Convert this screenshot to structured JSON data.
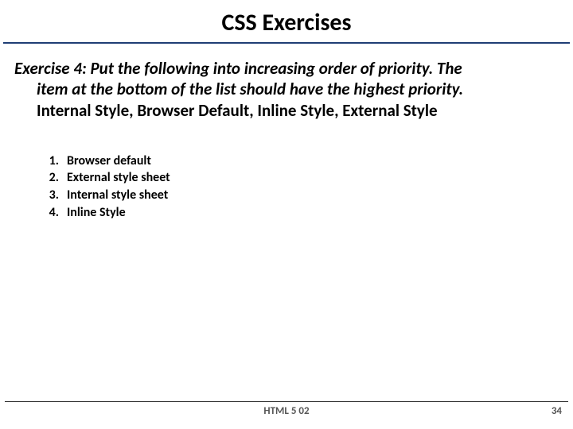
{
  "title": "CSS Exercises",
  "prompt": {
    "line1": "Exercise 4: Put the following into increasing order of priority. The",
    "line2": "item at the bottom of the list should have the highest priority.",
    "line3": "Internal Style, Browser Default, Inline Style, External Style"
  },
  "answers": [
    "Browser default",
    "External style sheet",
    "Internal style sheet",
    "Inline Style"
  ],
  "footer": {
    "center": "HTML 5 02",
    "page": "34"
  }
}
